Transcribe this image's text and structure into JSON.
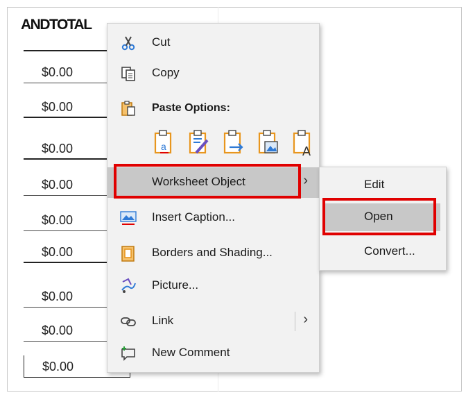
{
  "document": {
    "header_text": "ANDTOTAL",
    "amounts": [
      "$0.00",
      "$0.00",
      "$0.00",
      "$0.00",
      "$0.00",
      "$0.00",
      "$0.00",
      "$0.00",
      "$0.00"
    ]
  },
  "context_menu": {
    "cut": {
      "label": "Cut",
      "icon": "scissors-icon"
    },
    "copy": {
      "label": "Copy",
      "icon": "copy-icon"
    },
    "paste_options": {
      "label": "Paste Options:",
      "icon": "clipboard-icon",
      "icons": [
        "paste-keep-text-icon",
        "paste-merge-format-icon",
        "paste-link-icon",
        "paste-picture-icon",
        "paste-text-only-icon"
      ]
    },
    "worksheet_object": {
      "label": "Worksheet Object",
      "highlighted": true,
      "has_submenu": true
    },
    "insert_caption": {
      "label": "Insert Caption...",
      "icon": "caption-icon"
    },
    "borders_shading": {
      "label": "Borders and Shading...",
      "icon": "borders-icon"
    },
    "picture": {
      "label": "Picture...",
      "icon": "picture-format-icon"
    },
    "link": {
      "label": "Link",
      "icon": "link-icon",
      "has_submenu": true
    },
    "new_comment": {
      "label": "New Comment",
      "icon": "comment-icon"
    }
  },
  "submenu": {
    "edit": {
      "label": "Edit"
    },
    "open": {
      "label": "Open",
      "highlighted": true
    },
    "convert": {
      "label": "Convert..."
    }
  },
  "colors": {
    "highlight_box": "#e00000",
    "menu_bg": "#f2f2f2",
    "hover_bg": "#c8c8c8",
    "icon_accent": "#e8961e",
    "icon_blue": "#2f7ad6"
  }
}
